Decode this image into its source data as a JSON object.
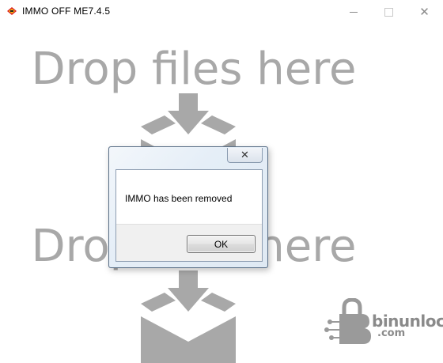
{
  "window": {
    "title": "IMMO OFF ME7.4.5",
    "controls": {
      "minimize": "minimize",
      "maximize": "maximize",
      "close": "close"
    }
  },
  "drop_zone": {
    "label_top": "Drop files here",
    "label_bottom": "Drop files here",
    "icon": "drop-box-arrow-icon"
  },
  "dialog": {
    "message": "IMMO has been removed",
    "ok_label": "OK",
    "close_icon": "close-icon"
  },
  "watermark": {
    "text": "binunlock",
    "subtext": ".com",
    "icon": "lock-b-logo"
  },
  "colors": {
    "drop_gray": "#a8a8a8",
    "dialog_frame": "#e3edf7"
  }
}
